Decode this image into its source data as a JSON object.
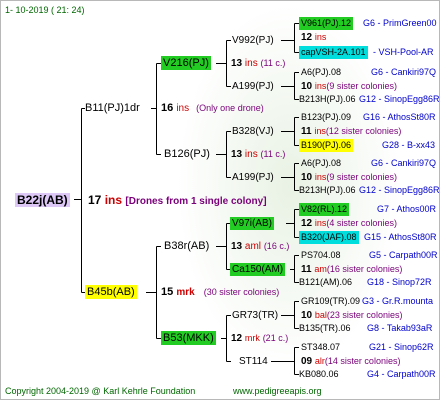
{
  "header": {
    "date": "1-  10-2019  (  21:  24)"
  },
  "footer": {
    "copyright": "Copyright 2004-2019 @ Karl Kehrle Foundation",
    "url": "www.pedigreeapis.org"
  },
  "colors": {
    "green": "#22cc22",
    "cyan": "#00dddd",
    "yellow": "#ffff00",
    "lavender": "#dcc7f7",
    "ins_red": "#cc0000",
    "info_blue": "#0000cc",
    "sister_purple": "#7a007a"
  },
  "root": {
    "name": "B22j(AB)",
    "num": "17",
    "unit": "ins",
    "note": "[Drones from 1 single colony]"
  },
  "g1": {
    "top": {
      "name": "B11(PJ)1dr",
      "num": "16",
      "unit": "ins",
      "note": "(Only one drone)"
    },
    "bottom": {
      "name": "B45b(AB)",
      "num": "15",
      "unit": "mrk",
      "note": "(30 sister colonies)"
    }
  },
  "g2": {
    "a": {
      "name": "V216(PJ)",
      "num": "13",
      "unit": "ins",
      "note": "(11 c.)"
    },
    "b": {
      "name": "B126(PJ)",
      "num": "13",
      "unit": "ins",
      "note": "(11 c.)"
    },
    "c": {
      "name": "B38r(AB)",
      "num": "13",
      "unit": "aml",
      "note": "(16 c.)"
    },
    "d": {
      "name": "B53(MKK)",
      "num": "12",
      "unit": "mrk",
      "note": "(21 c.)"
    }
  },
  "g3": {
    "a1": {
      "name": "V992(PJ)"
    },
    "a2": {
      "name": "A199(PJ)"
    },
    "b1": {
      "name": "B328(VJ)"
    },
    "b2": {
      "name": "A199(PJ)"
    },
    "c1": {
      "name": "V97i(AB)"
    },
    "c2": {
      "name": "Ca150(AM)"
    },
    "d1": {
      "name": "GR73(TR)"
    },
    "d2": {
      "name": "ST114"
    }
  },
  "g4": [
    {
      "top": "V961(PJ).12",
      "top_info": "G6 - PrimGreen00",
      "num": "12",
      "unit": "ins",
      "note": "",
      "bottom": "capVSH-2A.101",
      "bottom_info": "- VSH-Pool-AR"
    },
    {
      "top": "A6(PJ).08",
      "top_info": "G6 - Cankiri97Q",
      "num": "10",
      "unit": "ins",
      "note": "(9 sister colonies)",
      "bottom": "B213H(PJ).06",
      "bottom_info": "G12 - SinopEgg86R"
    },
    {
      "top": "B123(PJ).09",
      "top_info": "G16 - AthosSt80R",
      "num": "11",
      "unit": "ins",
      "note": "(12 sister colonies)",
      "bottom": "B190(PJ).06",
      "bottom_info": "G28 - B-xx43"
    },
    {
      "top": "A6(PJ).08",
      "top_info": "G6 - Cankiri97Q",
      "num": "10",
      "unit": "ins",
      "note": "(9 sister colonies)",
      "bottom": "B213H(PJ).06",
      "bottom_info": "G12 - SinopEgg86R"
    },
    {
      "top": "V82(RL).12",
      "top_info": "G7 - Athos00R",
      "num": "12",
      "unit": "ins",
      "note": "(4 sister colonies)",
      "bottom": "B320(JAF).08",
      "bottom_info": "G15 - AthosSt80R"
    },
    {
      "top": "PS704.08",
      "top_info": "G5 - Carpath00R",
      "num": "11",
      "unit": "am",
      "note": "(16 sister colonies)",
      "bottom": "B121(AM).06",
      "bottom_info": "G18 - Sinop72R"
    },
    {
      "top": "GR109(TR).09",
      "top_info": "G3 - Gr.R.mounta",
      "num": "10",
      "unit": "bal",
      "note": "(23 sister colonies)",
      "bottom": "B135(TR).06",
      "bottom_info": "G8 - Takab93aR"
    },
    {
      "top": "ST348.07",
      "top_info": "G21 - Sinop62R",
      "num": "09",
      "unit": "alr",
      "note": "(14 sister colonies)",
      "bottom": "KB080.06",
      "bottom_info": "G4 - Carpath00R"
    }
  ]
}
